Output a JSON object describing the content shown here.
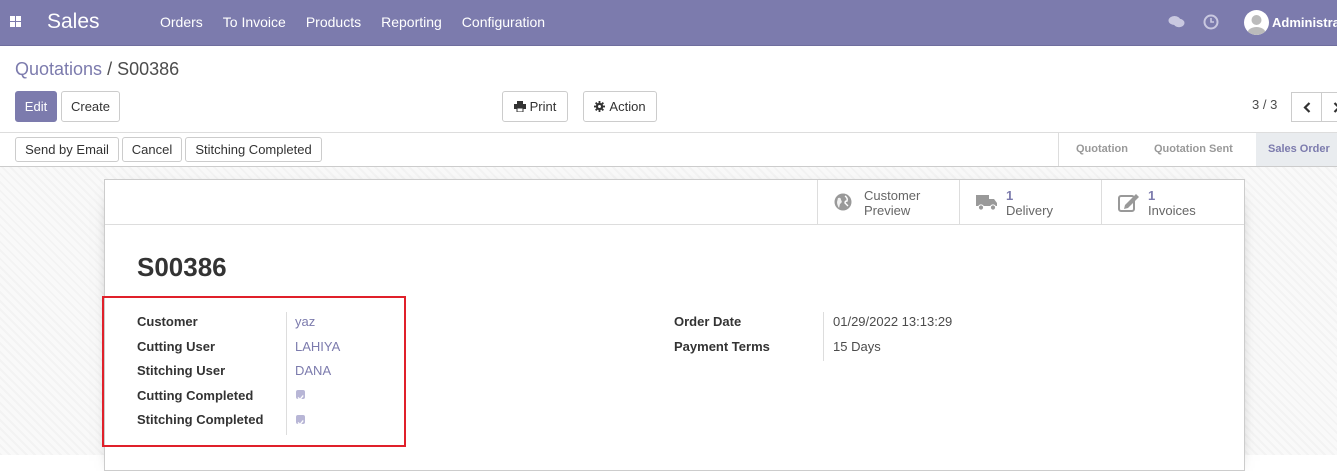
{
  "navbar": {
    "brand": "Sales",
    "menu": [
      "Orders",
      "To Invoice",
      "Products",
      "Reporting",
      "Configuration"
    ],
    "user": "Administrat",
    "icons": {
      "apps": "apps-grid-icon",
      "chat": "chat-icon",
      "activity": "clock-icon"
    }
  },
  "breadcrumb": {
    "parent": "Quotations",
    "separator": "/",
    "current": "S00386"
  },
  "toolbar": {
    "edit_label": "Edit",
    "create_label": "Create",
    "print_label": "Print",
    "action_label": "Action"
  },
  "pager": {
    "value": "3 / 3"
  },
  "statusbar": {
    "buttons": [
      "Send by Email",
      "Cancel",
      "Stitching Completed"
    ],
    "stages": [
      "Quotation",
      "Quotation Sent",
      "Sales Order"
    ],
    "active_stage": "Sales Order"
  },
  "smart_buttons": {
    "customer_preview": {
      "line1": "Customer",
      "line2": "Preview"
    },
    "delivery": {
      "count": "1",
      "label": "Delivery"
    },
    "invoices": {
      "count": "1",
      "label": "Invoices"
    }
  },
  "record": {
    "name": "S00386",
    "left_fields": [
      {
        "label": "Customer",
        "value": "yaz"
      },
      {
        "label": "Cutting User",
        "value": "LAHIYA"
      },
      {
        "label": "Stitching User",
        "value": "DANA"
      },
      {
        "label": "Cutting Completed",
        "checked": true
      },
      {
        "label": "Stitching Completed",
        "checked": true
      }
    ],
    "right_fields": [
      {
        "label": "Order Date",
        "value": "01/29/2022 13:13:29"
      },
      {
        "label": "Payment Terms",
        "value": "15 Days"
      }
    ]
  },
  "colors": {
    "brand": "#7c7bad",
    "highlight": "#e0202a"
  }
}
